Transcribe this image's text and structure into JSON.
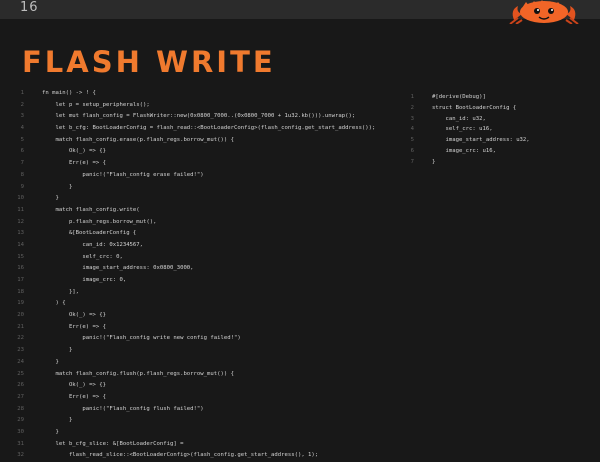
{
  "header": {
    "page_number": "16"
  },
  "slide": {
    "title": "FLASH WRITE"
  },
  "colors": {
    "accent": "#f07a2e",
    "keyword": "#e8873a",
    "function": "#d9c26a",
    "string": "#c586c0",
    "number": "#b08ee0",
    "field": "#c586c0",
    "comment": "#8f9bd0",
    "text": "#d4d4d4"
  },
  "code_main": {
    "lines": [
      {
        "n": "1",
        "text": "fn main() -> ! {"
      },
      {
        "n": "2",
        "text": "    let p = setup_peripherals();"
      },
      {
        "n": "3",
        "text": "    let mut flash_config = FlashWriter::new(0x0800_7000..(0x0800_7000 + 1u32.kb())).unwrap();"
      },
      {
        "n": "4",
        "text": "    let b_cfg: BootLoaderConfig = flash_read::<BootLoaderConfig>(flash_config.get_start_address());"
      },
      {
        "n": "5",
        "text": "    match flash_config.erase(p.flash_regs.borrow_mut()) {"
      },
      {
        "n": "6",
        "text": "        Ok(_) => {}"
      },
      {
        "n": "7",
        "text": "        Err(e) => {"
      },
      {
        "n": "8",
        "text": "            panic!(\"Flash_config erase failed!\")"
      },
      {
        "n": "9",
        "text": "        }"
      },
      {
        "n": "10",
        "text": "    }"
      },
      {
        "n": "11",
        "text": "    match flash_config.write("
      },
      {
        "n": "12",
        "text": "        p.flash_regs.borrow_mut(),"
      },
      {
        "n": "13",
        "text": "        &[BootLoaderConfig {"
      },
      {
        "n": "14",
        "text": "            can_id: 0x1234567,"
      },
      {
        "n": "15",
        "text": "            self_crc: 0,"
      },
      {
        "n": "16",
        "text": "            image_start_address: 0x0800_3000,"
      },
      {
        "n": "17",
        "text": "            image_crc: 0,"
      },
      {
        "n": "18",
        "text": "        }],"
      },
      {
        "n": "19",
        "text": "    ) {"
      },
      {
        "n": "20",
        "text": "        Ok(_) => {}"
      },
      {
        "n": "21",
        "text": "        Err(e) => {"
      },
      {
        "n": "22",
        "text": "            panic!(\"Flash_config write new config failed!\")"
      },
      {
        "n": "23",
        "text": "        }"
      },
      {
        "n": "24",
        "text": "    }"
      },
      {
        "n": "25",
        "text": "    match flash_config.flush(p.flash_regs.borrow_mut()) {"
      },
      {
        "n": "26",
        "text": "        Ok(_) => {}"
      },
      {
        "n": "27",
        "text": "        Err(e) => {"
      },
      {
        "n": "28",
        "text": "            panic!(\"Flash_config flush failed!\")"
      },
      {
        "n": "29",
        "text": "        }"
      },
      {
        "n": "30",
        "text": "    }"
      },
      {
        "n": "31",
        "text": "    let b_cfg_slice: &[BootLoaderConfig] ="
      },
      {
        "n": "32",
        "text": "        flash_read_slice::<BootLoaderConfig>(flash_config.get_start_address(), 1);"
      }
    ]
  },
  "code_side": {
    "lines": [
      {
        "n": "1",
        "text": "#[derive(Debug)]"
      },
      {
        "n": "2",
        "text": "struct BootLoaderConfig {"
      },
      {
        "n": "3",
        "text": "    can_id: u32,"
      },
      {
        "n": "4",
        "text": "    self_crc: u16,"
      },
      {
        "n": "5",
        "text": "    image_start_address: u32,"
      },
      {
        "n": "6",
        "text": "    image_crc: u16,"
      },
      {
        "n": "7",
        "text": "}"
      }
    ]
  }
}
